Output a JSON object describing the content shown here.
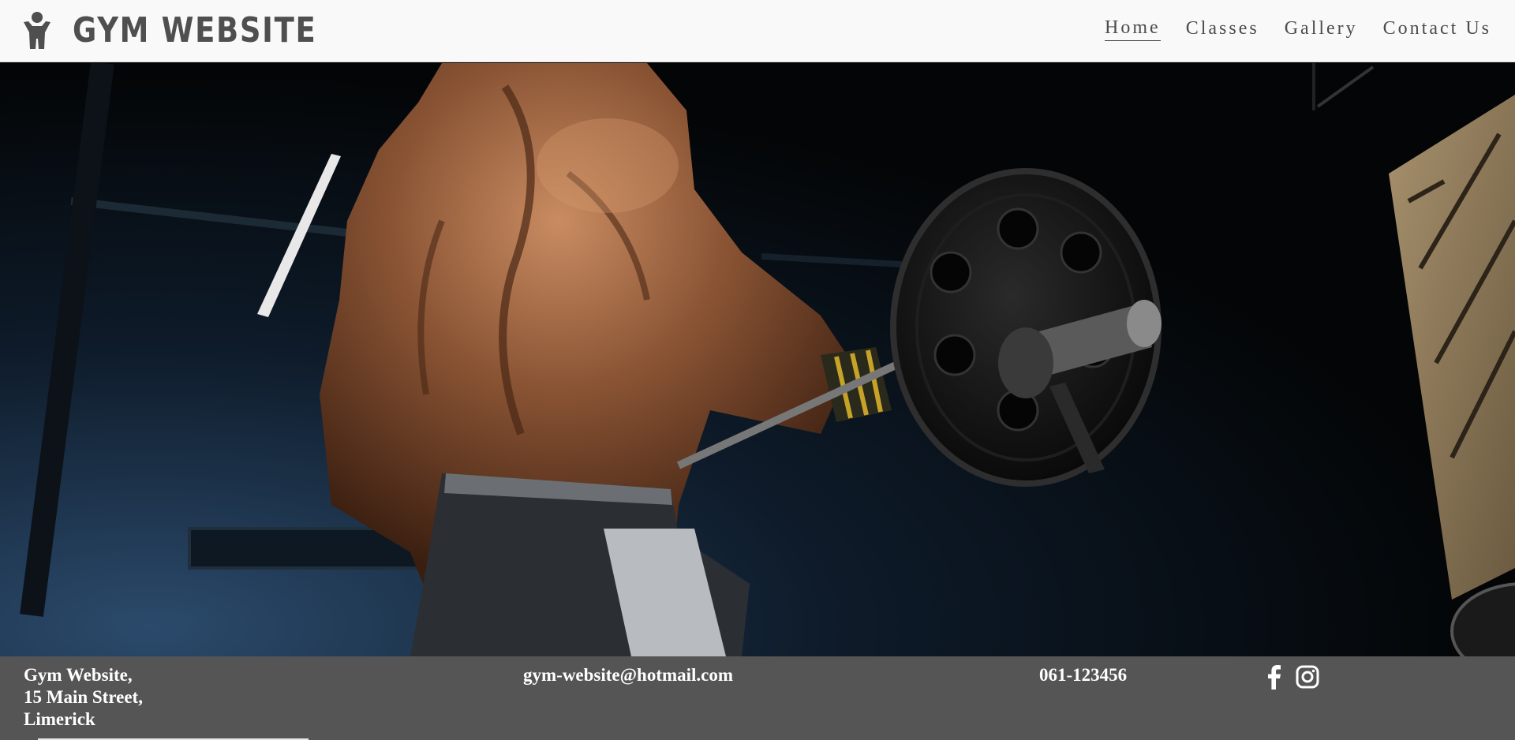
{
  "header": {
    "brand": "GYM WEBSITE",
    "brand_icon": "person-icon",
    "nav": [
      {
        "label": "Home",
        "active": true
      },
      {
        "label": "Classes",
        "active": false
      },
      {
        "label": "Gallery",
        "active": false
      },
      {
        "label": "Contact Us",
        "active": false
      }
    ]
  },
  "hero": {
    "image": "bodybuilder-lifting-barbell-photo"
  },
  "footer": {
    "address": [
      "Gym Website,",
      "15 Main Street,",
      "Limerick"
    ],
    "email": "gym-website@hotmail.com",
    "phone": "061-123456",
    "social": [
      "facebook-icon",
      "instagram-icon"
    ]
  },
  "colors": {
    "header_bg": "#f9f9f9",
    "brand_text": "#4f4f4f",
    "footer_bg": "#555555",
    "footer_text": "#ffffff"
  }
}
